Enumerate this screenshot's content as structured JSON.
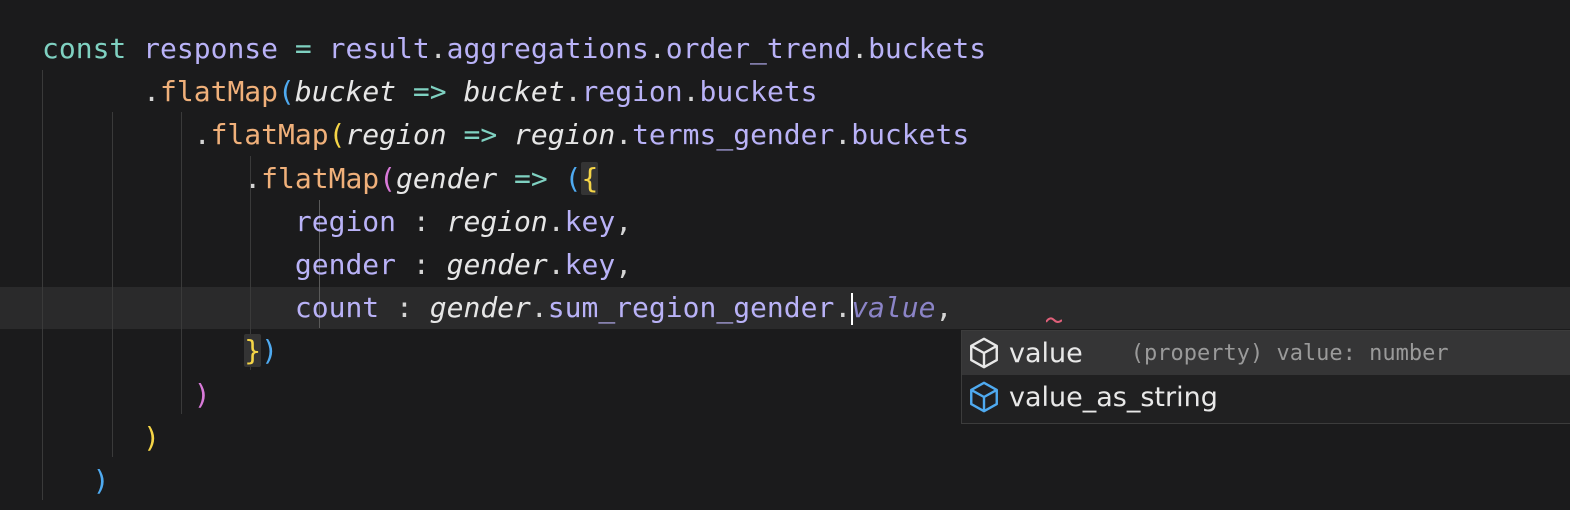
{
  "editor": {
    "lines": [
      {
        "tokens": [
          {
            "t": "const",
            "c": "kw"
          },
          {
            "t": " ",
            "c": "punc"
          },
          {
            "t": "response",
            "c": "var"
          },
          {
            "t": " ",
            "c": "punc"
          },
          {
            "t": "=",
            "c": "op"
          },
          {
            "t": " ",
            "c": "punc"
          },
          {
            "t": "result",
            "c": "var"
          },
          {
            "t": ".",
            "c": "punc"
          },
          {
            "t": "aggregations",
            "c": "var"
          },
          {
            "t": ".",
            "c": "punc"
          },
          {
            "t": "order_trend",
            "c": "var"
          },
          {
            "t": ".",
            "c": "punc"
          },
          {
            "t": "buckets",
            "c": "var"
          }
        ]
      },
      {
        "indent": "      ",
        "tokens": [
          {
            "t": ".",
            "c": "punc"
          },
          {
            "t": "flatMap",
            "c": "fn"
          },
          {
            "t": "(",
            "c": "b3"
          },
          {
            "t": "bucket",
            "c": "param"
          },
          {
            "t": " ",
            "c": "punc"
          },
          {
            "t": "=>",
            "c": "op"
          },
          {
            "t": " ",
            "c": "punc"
          },
          {
            "t": "bucket",
            "c": "param"
          },
          {
            "t": ".",
            "c": "punc"
          },
          {
            "t": "region",
            "c": "var"
          },
          {
            "t": ".",
            "c": "punc"
          },
          {
            "t": "buckets",
            "c": "var"
          }
        ]
      },
      {
        "indent": "         ",
        "tokens": [
          {
            "t": ".",
            "c": "punc"
          },
          {
            "t": "flatMap",
            "c": "fn"
          },
          {
            "t": "(",
            "c": "b1"
          },
          {
            "t": "region",
            "c": "param"
          },
          {
            "t": " ",
            "c": "punc"
          },
          {
            "t": "=>",
            "c": "op"
          },
          {
            "t": " ",
            "c": "punc"
          },
          {
            "t": "region",
            "c": "param"
          },
          {
            "t": ".",
            "c": "punc"
          },
          {
            "t": "terms_gender",
            "c": "var"
          },
          {
            "t": ".",
            "c": "punc"
          },
          {
            "t": "buckets",
            "c": "var"
          }
        ]
      },
      {
        "indent": "            ",
        "tokens": [
          {
            "t": ".",
            "c": "punc"
          },
          {
            "t": "flatMap",
            "c": "fn"
          },
          {
            "t": "(",
            "c": "b2"
          },
          {
            "t": "gender",
            "c": "param"
          },
          {
            "t": " ",
            "c": "punc"
          },
          {
            "t": "=>",
            "c": "op"
          },
          {
            "t": " ",
            "c": "punc"
          },
          {
            "t": "(",
            "c": "b3"
          },
          {
            "t": "{",
            "c": "b1",
            "hl": true
          }
        ]
      },
      {
        "indent": "               ",
        "tokens": [
          {
            "t": "region",
            "c": "var"
          },
          {
            "t": " ",
            "c": "punc"
          },
          {
            "t": ":",
            "c": "punc"
          },
          {
            "t": " ",
            "c": "punc"
          },
          {
            "t": "region",
            "c": "param"
          },
          {
            "t": ".",
            "c": "punc"
          },
          {
            "t": "key",
            "c": "var"
          },
          {
            "t": ",",
            "c": "punc"
          }
        ]
      },
      {
        "indent": "               ",
        "tokens": [
          {
            "t": "gender",
            "c": "var"
          },
          {
            "t": " ",
            "c": "punc"
          },
          {
            "t": ":",
            "c": "punc"
          },
          {
            "t": " ",
            "c": "punc"
          },
          {
            "t": "gender",
            "c": "param"
          },
          {
            "t": ".",
            "c": "punc"
          },
          {
            "t": "key",
            "c": "var"
          },
          {
            "t": ",",
            "c": "punc"
          }
        ]
      },
      {
        "indent": "               ",
        "current": true,
        "tokens": [
          {
            "t": "count",
            "c": "var"
          },
          {
            "t": " ",
            "c": "punc"
          },
          {
            "t": ":",
            "c": "punc"
          },
          {
            "t": " ",
            "c": "punc"
          },
          {
            "t": "gender",
            "c": "param"
          },
          {
            "t": ".",
            "c": "punc"
          },
          {
            "t": "sum_region_gender",
            "c": "var"
          },
          {
            "t": ".",
            "c": "punc"
          },
          {
            "cursor": true
          },
          {
            "t": "value",
            "c": "ghost"
          },
          {
            "t": ",",
            "c": "punc"
          }
        ]
      },
      {
        "indent": "            ",
        "tokens": [
          {
            "t": "}",
            "c": "b1",
            "hl": true
          },
          {
            "t": ")",
            "c": "b3"
          }
        ]
      },
      {
        "indent": "         ",
        "tokens": [
          {
            "t": ")",
            "c": "b2"
          }
        ]
      },
      {
        "indent": "      ",
        "tokens": [
          {
            "t": ")",
            "c": "b1"
          }
        ]
      },
      {
        "indent": "   ",
        "tokens": [
          {
            "t": ")",
            "c": "b3"
          }
        ]
      }
    ]
  },
  "suggestions": {
    "items": [
      {
        "label": "value",
        "detail": "(property) value: number",
        "icon": "property-icon",
        "selected": true
      },
      {
        "label": "value_as_string",
        "detail": "",
        "icon": "property-icon",
        "selected": false
      }
    ]
  },
  "colors": {
    "background": "#1b1b1c",
    "keyword": "#7fd1c1",
    "variable": "#b9b2f7",
    "function": "#f0b07a",
    "bracket_yellow": "#f5d547",
    "bracket_purple": "#d97ad9",
    "bracket_blue": "#4faaf0",
    "suggest_icon_selected": "#e8e8e8",
    "suggest_icon": "#4faaf0"
  }
}
